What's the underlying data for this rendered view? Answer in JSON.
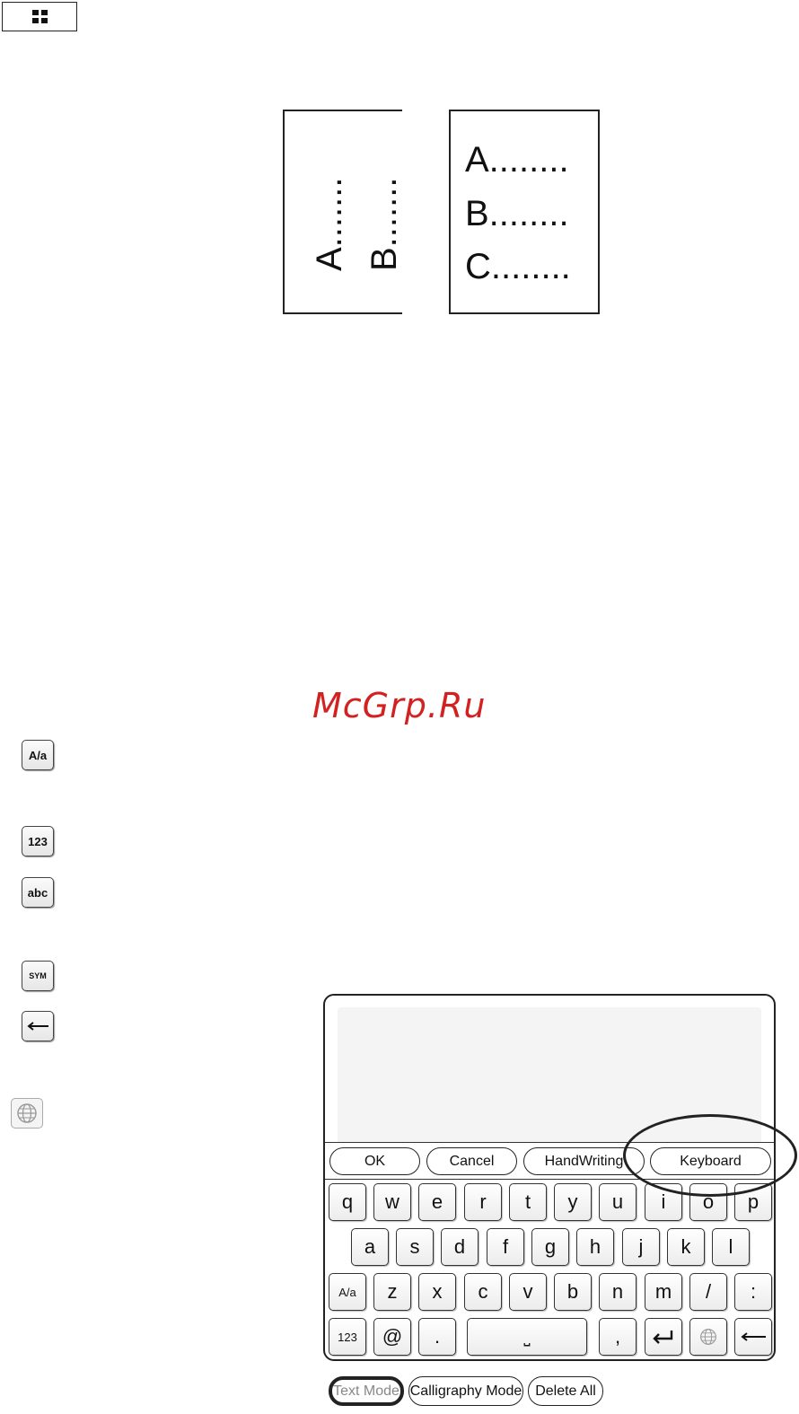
{
  "top_button": {
    "icon": "grid-menu-icon"
  },
  "illustration": {
    "left_page_lines": [
      "A.......",
      "B......."
    ],
    "right_page_lines": [
      "A........",
      "B........",
      "C........"
    ]
  },
  "watermark": "McGrp.Ru",
  "legend": [
    {
      "label": "A/a",
      "icon": "shift-key"
    },
    {
      "label": "123",
      "icon": "numbers-key"
    },
    {
      "label": "abc",
      "icon": "letters-key"
    },
    {
      "label": "SYM",
      "icon": "symbols-key"
    },
    {
      "label": "←",
      "icon": "backspace-arrow-icon"
    },
    {
      "label": "",
      "icon": "globe-icon"
    }
  ],
  "dialog": {
    "buttons": {
      "ok": "OK",
      "cancel": "Cancel",
      "handwriting": "HandWriting",
      "keyboard": "Keyboard"
    },
    "rows": [
      [
        "q",
        "w",
        "e",
        "r",
        "t",
        "y",
        "u",
        "i",
        "o",
        "p"
      ],
      [
        "a",
        "s",
        "d",
        "f",
        "g",
        "h",
        "j",
        "k",
        "l"
      ],
      [
        "A/a",
        "z",
        "x",
        "c",
        "v",
        "b",
        "n",
        "m",
        "/",
        ":"
      ],
      [
        "123",
        "@",
        ".",
        "⎵",
        ",",
        "↵",
        "globe",
        "←"
      ]
    ]
  },
  "bottom_modes": {
    "text": "Text Mode",
    "calligraphy": "Calligraphy Mode",
    "delete": "Delete All",
    "active": "Text Mode"
  }
}
